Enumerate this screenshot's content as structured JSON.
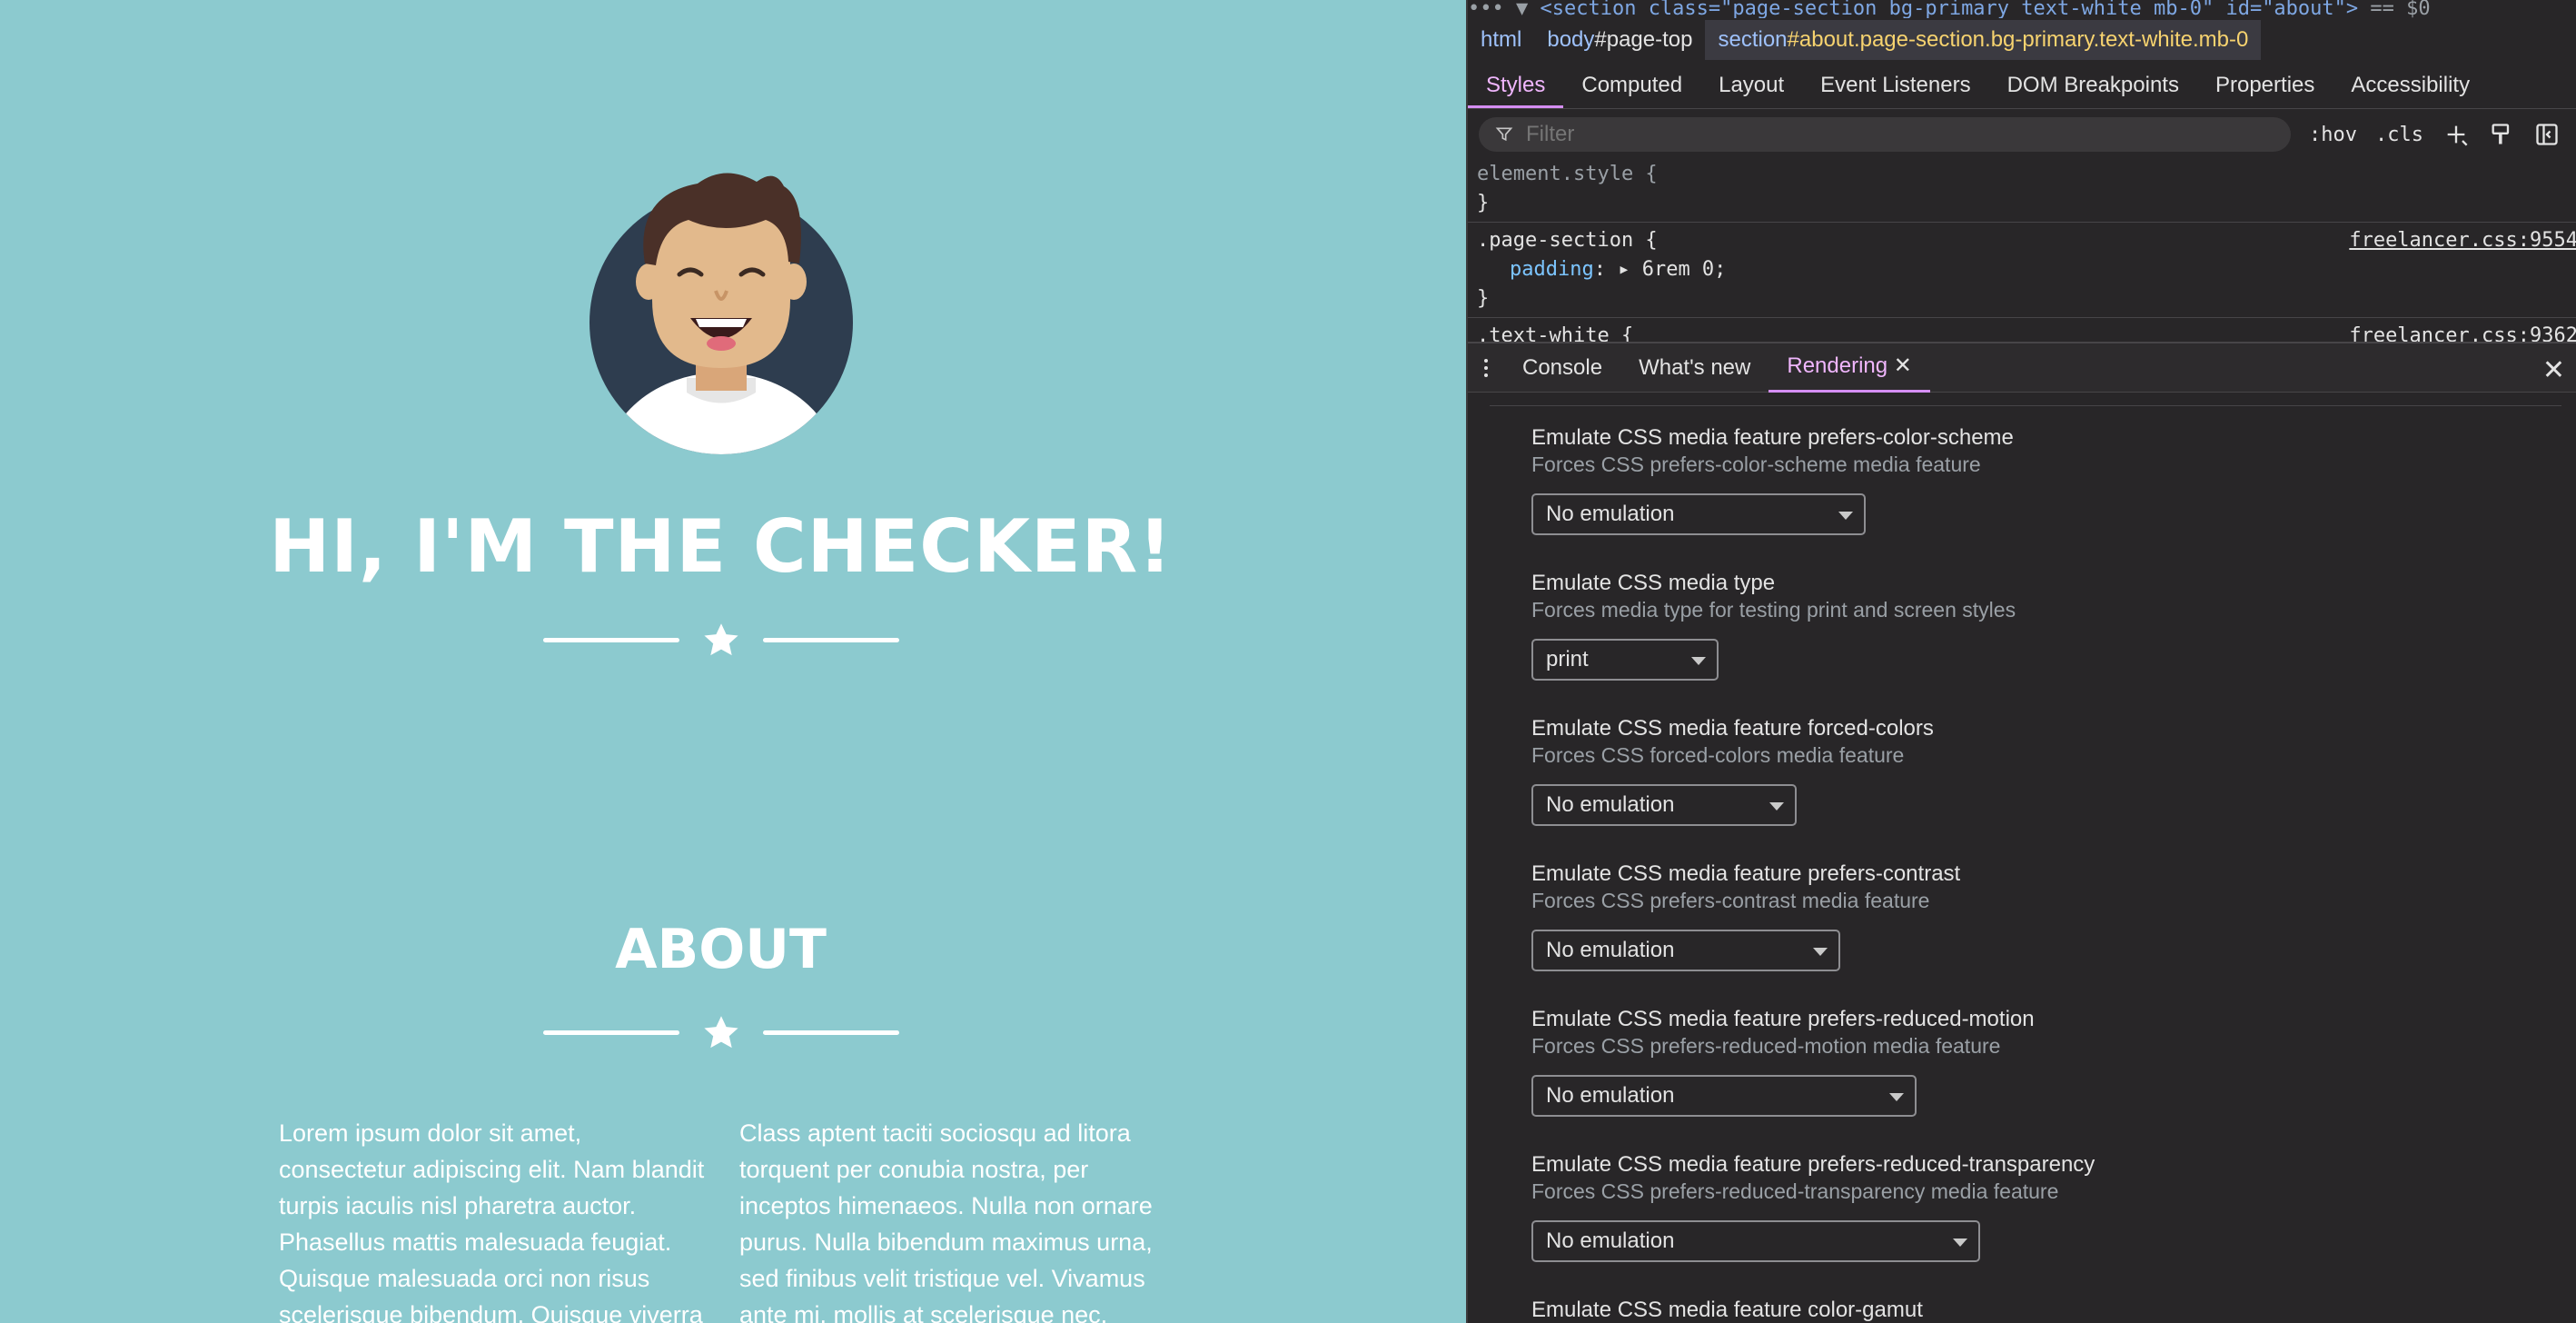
{
  "page": {
    "masthead_title": "HI, I'M THE CHECKER!",
    "about_title": "ABOUT",
    "about_left": "Lorem ipsum dolor sit amet, consectetur adipiscing elit. Nam blandit turpis iaculis nisl pharetra auctor. Phasellus mattis malesuada feugiat. Quisque malesuada orci non risus scelerisque bibendum. Quisque viverra vulputate posuere.",
    "about_right": "Class aptent taciti sociosqu ad litora torquent per conubia nostra, per inceptos himenaeos. Nulla non ornare purus. Nulla bibendum maximus urna, sed finibus velit tristique vel. Vivamus ante mi, mollis at scelerisque nec, feugiat a nulla.",
    "colors": {
      "background": "#8ccacf",
      "text": "#ffffff"
    }
  },
  "devtools": {
    "dom_line": {
      "prefix": "••• ▼",
      "tag_open": "<section class=\"page-section bg-primary text-white mb-0\" id=\"about\">",
      "suffix": " == $0"
    },
    "breadcrumbs": [
      {
        "tag": "html",
        "rest": ""
      },
      {
        "tag": "body",
        "rest": "#page-top"
      },
      {
        "tag": "section",
        "rest": "#about.page-section.bg-primary.text-white.mb-0"
      }
    ],
    "styles_tabs": [
      "Styles",
      "Computed",
      "Layout",
      "Event Listeners",
      "DOM Breakpoints",
      "Properties",
      "Accessibility"
    ],
    "filter_placeholder": "Filter",
    "toolbar": {
      "hov": ":hov",
      "cls": ".cls"
    },
    "rules": {
      "element_style": "element.style {",
      "close": "}",
      "page_section_selector": ".page-section {",
      "page_section_source": "freelancer.css:9554",
      "padding_prop": "padding",
      "padding_value": "6rem 0;",
      "text_white_selector": ".text-white {",
      "text_white_source": "freelancer.css:9362"
    },
    "drawer_tabs": [
      "Console",
      "What's new",
      "Rendering"
    ],
    "rendering_options": [
      {
        "title": "Emulate CSS media feature prefers-color-scheme",
        "desc": "Forces CSS prefers-color-scheme media feature",
        "value": "No emulation"
      },
      {
        "title": "Emulate CSS media type",
        "desc": "Forces media type for testing print and screen styles",
        "value": "print"
      },
      {
        "title": "Emulate CSS media feature forced-colors",
        "desc": "Forces CSS forced-colors media feature",
        "value": "No emulation"
      },
      {
        "title": "Emulate CSS media feature prefers-contrast",
        "desc": "Forces CSS prefers-contrast media feature",
        "value": "No emulation"
      },
      {
        "title": "Emulate CSS media feature prefers-reduced-motion",
        "desc": "Forces CSS prefers-reduced-motion media feature",
        "value": "No emulation"
      },
      {
        "title": "Emulate CSS media feature prefers-reduced-transparency",
        "desc": "Forces CSS prefers-reduced-transparency media feature",
        "value": "No emulation"
      },
      {
        "title": "Emulate CSS media feature color-gamut",
        "desc": "",
        "value": ""
      }
    ]
  }
}
